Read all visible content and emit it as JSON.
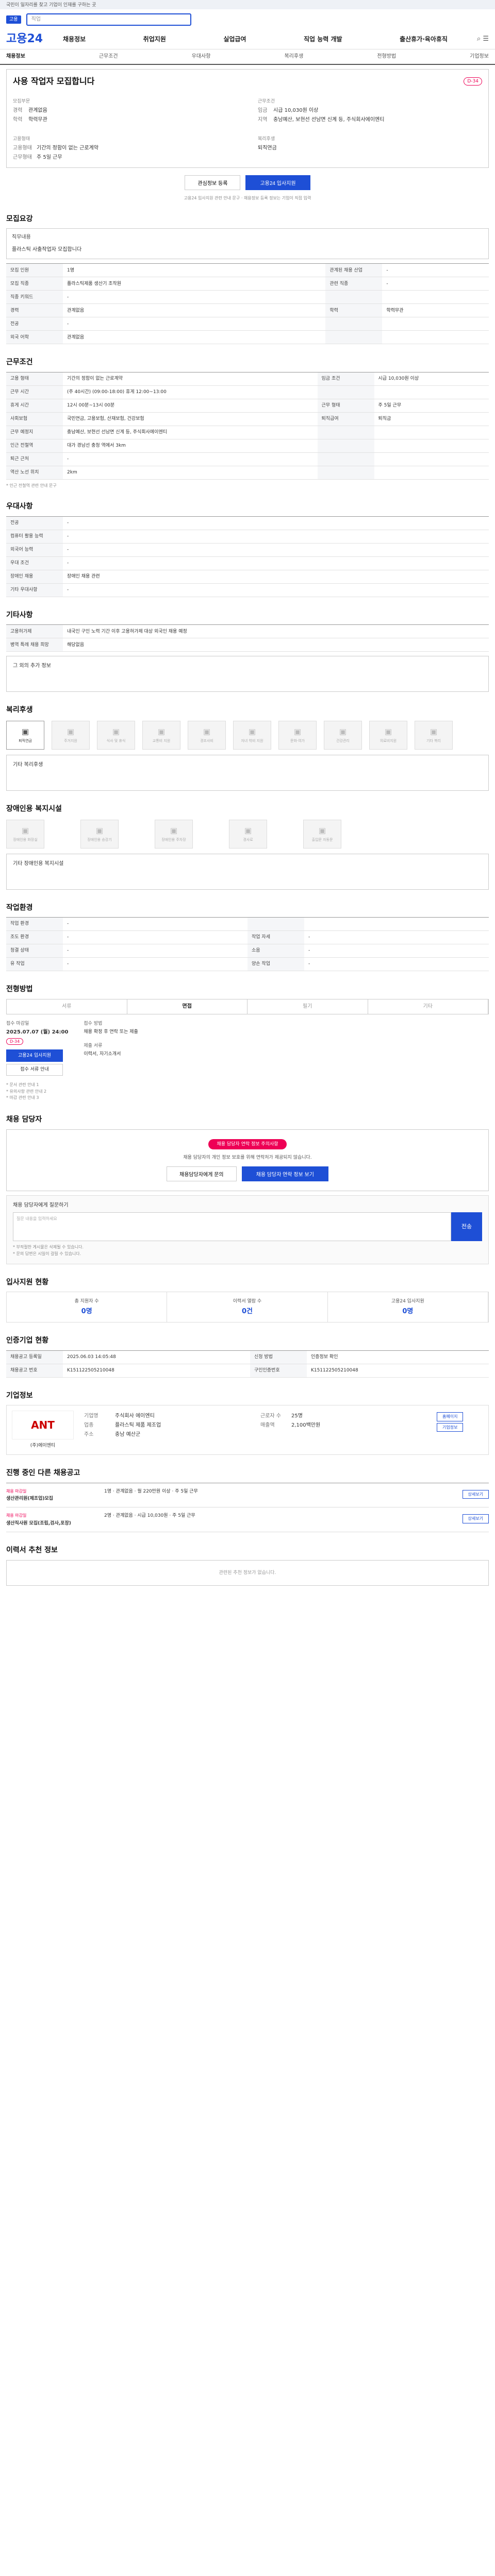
{
  "topbar": {
    "text": "국민이 일자리를 찾고 기업이 인재를 구하는 곳"
  },
  "search": {
    "tag": "고용",
    "placeholder": "직업"
  },
  "header": {
    "logo": "고용24",
    "nav": [
      "채용정보",
      "취업지원",
      "실업급여",
      "직업 능력 개발",
      "출산휴가·육아휴직"
    ],
    "icons": "⌕ ☰"
  },
  "tabs": [
    "채용정보",
    "근무조건",
    "우대사항",
    "복리후생",
    "전형방법",
    "기업정보"
  ],
  "job": {
    "title": "사용 작업자 모집합니다",
    "dday": "D-34",
    "left": {
      "sec1": "모집부문",
      "rows": [
        {
          "k": "경력",
          "v": "관계없음"
        },
        {
          "k": "학력",
          "v": "학력무관"
        }
      ],
      "sec2": "고용형태",
      "rows2": [
        {
          "k": "고용형태",
          "v": "기간의 정함이 없는 근로계약"
        },
        {
          "k": "근무형태",
          "v": "주 5일 근무"
        }
      ]
    },
    "right": {
      "sec1": "근무조건",
      "rows": [
        {
          "k": "임금",
          "v": "시급 10,030원 이상"
        },
        {
          "k": "지역",
          "v": "충남예산, 보현선 선남면 신계 등, 주식회사에이엔티"
        }
      ],
      "sec2": "복리후생",
      "rows2": [
        {
          "k": "",
          "v": "퇴직연금"
        }
      ]
    },
    "btn_scrap": "관심정보 등록",
    "btn_apply": "고용24 입사지원",
    "note": "고용24 입사지원 관련 안내 문구 · 채용정보 등록 정보는 기업이 직접 입력"
  },
  "sections": {
    "recruit": "모집요강",
    "worktype": "근무조건",
    "pref": "우대사항",
    "other": "기타사항",
    "welfare": "복리후생",
    "disabled": "장애인용 복지시설",
    "env": "작업환경",
    "method": "전형방법",
    "contact": "채용 담당자",
    "stats": "입사지원 현황",
    "info": "인증기업 현황",
    "company": "기업정보",
    "related": "진행 중인 다른 채용공고",
    "recommend": "이력서 추천 정보"
  },
  "recruit": {
    "sub1": "직무내용",
    "desc": "플라스틱 사출작업자 모집합니다",
    "rows": [
      [
        "모집 인원",
        "1명",
        "관계된 채용 산업",
        "-"
      ],
      [
        "모집 직종",
        "플라스틱제품 생산기 조작원",
        "관련 직종",
        "-"
      ],
      [
        "직종 키워드",
        "-",
        "",
        ""
      ],
      [
        "경력",
        "관계없음",
        "학력",
        "학력무관"
      ],
      [
        "전공",
        "-",
        "",
        ""
      ],
      [
        "외국 어학",
        "관계없음",
        "",
        ""
      ]
    ]
  },
  "work": {
    "rows": [
      [
        "고용 형태",
        "기간의 정함이 없는 근로계약",
        "임금 조건",
        "시급 10,030원 이상"
      ],
      [
        "근무 시간",
        "(주 40시간)\n(09:00-18:00) 휴게 12:00~13:00",
        "",
        ""
      ],
      [
        "휴게 시간",
        "12시 00분~13시 00분",
        "근무 형태",
        "주 5일 근무"
      ],
      [
        "사회보험",
        "국민연금, 고용보험, 산재보험, 건강보험",
        "퇴직급여",
        "퇴직금"
      ],
      [
        "근무 예정지",
        "충남예산, 보현선 선남면 신계 등, 주식회사에이엔티",
        "",
        ""
      ],
      [
        "인근 전철역",
        "대가 경남선 충청 역에서 3km",
        "",
        ""
      ],
      [
        "퇴근 근처",
        "-",
        "",
        ""
      ],
      [
        "역산 노선 위치",
        "2km",
        "",
        ""
      ]
    ],
    "note": "* 인근 전철역 관련 안내 문구"
  },
  "pref_rows": [
    [
      "전공",
      "-"
    ],
    [
      "컴퓨터 활용 능력",
      "-"
    ],
    [
      "외국어 능력",
      "-"
    ],
    [
      "우대 조건",
      "-"
    ],
    [
      "장애인 채용",
      "장애인 채용 관련"
    ],
    [
      "기타 우대사항",
      "-"
    ]
  ],
  "other_rows": [
    [
      "고용허가제",
      "내국인 구인 노력 기간 이후 고용허가제 대상 외국인 채용 예정"
    ],
    [
      "병역 특례 채용 희망",
      "해당없음"
    ]
  ],
  "other_sub": "그 외의 추가 정보",
  "welfare_icons": [
    "퇴직연금",
    "주거지원",
    "식사 및 휴식",
    "교통비 지원",
    "경조사비",
    "자녀 학비 지원",
    "문화·여가",
    "건강관리",
    "의료비지원",
    "기타 복리"
  ],
  "welfare_other": "기타 복리후생",
  "disabled_icons": [
    "장애인용 화장실",
    "장애인용 승강기",
    "장애인용 주차장",
    "경사로",
    "출입문 자동문"
  ],
  "disabled_other": "기타 장애인용 복지시설",
  "env_rows": [
    [
      "작업 환경",
      "-",
      "",
      ""
    ],
    [
      "조도 환경",
      "-",
      "작업 자세",
      "-"
    ],
    [
      "청결 상태",
      "-",
      "소음",
      "-"
    ],
    [
      "유 작업",
      "-",
      "양손 작업",
      "-"
    ]
  ],
  "method": {
    "tabs": [
      "서류",
      "면접",
      "필기",
      "기타"
    ],
    "dlabel": "접수 마감일",
    "date": "2025.07.07 (월) 24:00",
    "dpill": "D-34",
    "btn1": "고용24 입사지원",
    "btn2": "접수 서류 안내",
    "mlabel": "접수 방법",
    "mval": "채용 확정 후 연락 또는 제출",
    "slabel": "제출 서류",
    "sval": "이력서, 자기소개서"
  },
  "method_notes": [
    "* 문서 관련 안내 1",
    "* 유의사항 관련 안내 2",
    "* 마감 관련 안내 3"
  ],
  "contact": {
    "alert": "채용 담당자 연락 정보 주의사항",
    "txt": "채용 담당자의 개인 정보 보호를 위해 연락처가 제공되지 않습니다.",
    "btn1": "채용담당자에게 문의",
    "btn2": "채용 담당자 연락 정보 보기"
  },
  "qa": {
    "label": "채용 담당자에게 질문하기",
    "placeholder": "질문 내용을 입력하세요",
    "send": "전송",
    "bullets": [
      "* 부적절한 게시물은 삭제될 수 있습니다.",
      "* 문의 답변은 시일이 걸릴 수 있습니다."
    ]
  },
  "stats": [
    [
      "총 지원자 수",
      "0명"
    ],
    [
      "이력서 열람 수",
      "0건"
    ],
    [
      "고용24 입사지원",
      "0명"
    ]
  ],
  "info_rows": [
    [
      "채용공고 등록일",
      "2025.06.03 14:05:48",
      "신청 방법",
      "인증정보 확인"
    ],
    [
      "채용공고 번호",
      "K151122505210048",
      "구인인증번호",
      "K151122505210048"
    ]
  ],
  "company": {
    "name": "(주)에이엔티",
    "logo": "ANT",
    "sales": "-",
    "rows": [
      {
        "k": "기업명",
        "v": "주식회사 에이엔티"
      },
      {
        "k": "업종",
        "v": "플라스틱 제품 제조업"
      },
      {
        "k": "주소",
        "v": "충남 예산군"
      },
      {
        "k": "근로자 수",
        "v": "25명"
      },
      {
        "k": "매출액",
        "v": "2,100백만원"
      }
    ],
    "btn1": "홈페이지",
    "btn2": "기업정보"
  },
  "related": [
    {
      "tag": "채용 마감일",
      "title": "생산관리원(제조업)모집",
      "cond": [
        "1명",
        "관계없음",
        "월 220만원 이상",
        "주 5일 근무"
      ],
      "btn": "상세보기"
    },
    {
      "tag": "채용 마감일",
      "title": "생산직사원 모집(조립,검사,포장)",
      "cond": [
        "2명",
        "관계없음",
        "시급 10,030원",
        "주 5일 근무"
      ],
      "btn": "상세보기"
    }
  ],
  "recommend": {
    "empty": "관련된 추천 정보가 없습니다."
  }
}
